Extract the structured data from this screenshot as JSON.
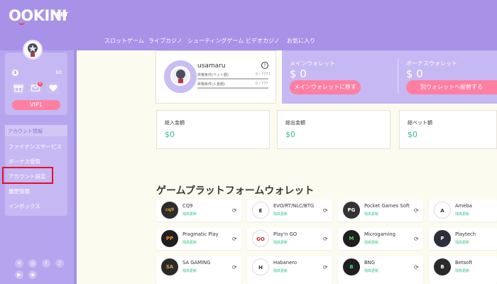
{
  "brand": {
    "logo": "OOKINI",
    "logo_suffix": "BET"
  },
  "nav": {
    "items": [
      {
        "label": "スロットゲーム"
      },
      {
        "label": "ライブカジノ"
      },
      {
        "label": "シューティングゲーム"
      },
      {
        "label": "ビデオカジノ"
      },
      {
        "label": "お気に入り"
      }
    ]
  },
  "sidebar": {
    "balance_symbol": "$",
    "balance": "$0",
    "mail_badge": "0",
    "vip_label": "VIP1",
    "menu_header": "アカウント情報",
    "menu_items": [
      {
        "label": "ファイナンスサービス"
      },
      {
        "label": "ボーナス受取"
      },
      {
        "label": "アカウント設定"
      },
      {
        "label": "履歴情報"
      },
      {
        "label": "インボックス"
      }
    ],
    "social_icons": [
      "x-icon",
      "instagram-icon",
      "facebook-icon",
      "tiktok-icon",
      "youtube-icon",
      "line-icon"
    ]
  },
  "profile": {
    "username": "usamaru",
    "bar1_label": "昇格条件(ベット額)",
    "bar1_value": "0 / 7777",
    "bar2_label": "昇格条件(入金額)",
    "bar2_value": "0 / 777",
    "info_symbol": "!"
  },
  "wallets": {
    "main_title": "メインウォレット",
    "main_value": "$ 0",
    "main_button": "メインウォレットに移す",
    "bonus_title": "ボーナスウォレット",
    "bonus_value": "$ 0",
    "bonus_button": "別ウォレットへ振替する"
  },
  "stats": [
    {
      "title": "総入金額",
      "value": "$0"
    },
    {
      "title": "総出金額",
      "value": "$0"
    },
    {
      "title": "総ベット額",
      "value": "$0"
    }
  ],
  "section_title": "ゲームプラットフォームウォレット",
  "platforms": [
    {
      "name": "CQ9",
      "sub": "残高更新",
      "logo": "cq9"
    },
    {
      "name": "EVO/RT/NLC/BTG",
      "sub": "残高更新",
      "logo": "E"
    },
    {
      "name": "Pocket Games Soft",
      "sub": "残高更新",
      "logo": "PG"
    },
    {
      "name": "Ameba",
      "sub": "残高更新",
      "logo": "A"
    },
    {
      "name": "Pragmatic Play",
      "sub": "残高更新",
      "logo": "PP"
    },
    {
      "name": "Play'n GO",
      "sub": "残高更新",
      "logo": "GO"
    },
    {
      "name": "Microgaming",
      "sub": "残高更新",
      "logo": "M"
    },
    {
      "name": "Playtech",
      "sub": "残高更新",
      "logo": "P"
    },
    {
      "name": "SA GAMING",
      "sub": "残高更新",
      "logo": "SA"
    },
    {
      "name": "Habanero",
      "sub": "残高更新",
      "logo": "H"
    },
    {
      "name": "BNG",
      "sub": "残高更新",
      "logo": "B"
    },
    {
      "name": "Betsoft",
      "sub": "残高更新",
      "logo": "B"
    }
  ],
  "colors": {
    "header": "#a892e8",
    "sidebar": "#b6a4ee",
    "accent_pink": "#ff7fa2",
    "green": "#32c28a",
    "highlight_red": "#e3102a",
    "page_bg": "#fcfbef"
  }
}
